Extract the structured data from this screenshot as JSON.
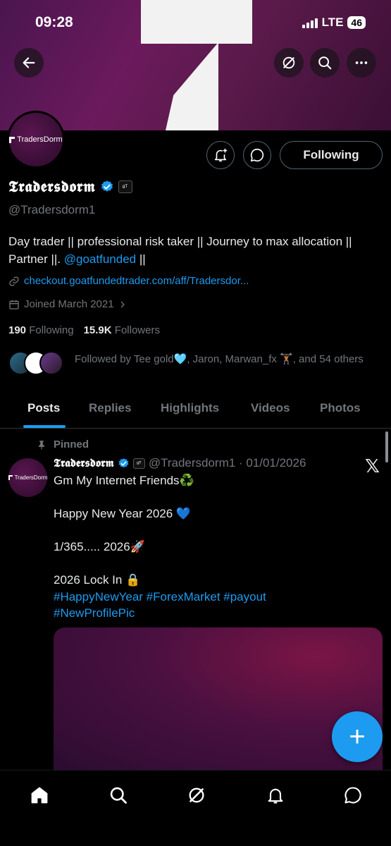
{
  "status_bar": {
    "time": "09:28",
    "network": "LTE",
    "battery": "46"
  },
  "profile": {
    "avatar_label": "TradersDorm",
    "name": "𝕿𝖗𝖆𝖉𝖊𝖗𝖘𝖉𝖔𝖗𝖒",
    "affiliate_badge": "ᵍᵀ",
    "handle": "@Tradersdorm1",
    "bio_text": "Day trader || professional risk taker || Journey to max allocation || Partner ||.",
    "bio_mention": "@goatfunded",
    "bio_suffix": "||",
    "link": "checkout.goatfundedtrader.com/aff/Tradersdor...",
    "joined": "Joined March 2021",
    "following_count": "190",
    "following_label": "Following",
    "followers_count": "15.9K",
    "followers_label": "Followers",
    "followed_by": "Followed by Tee gold🩵, Jaron, Marwan_fx 🏋🏿, and 54 others",
    "follow_button": "Following"
  },
  "tabs": [
    "Posts",
    "Replies",
    "Highlights",
    "Videos",
    "Photos"
  ],
  "post": {
    "pinned_label": "Pinned",
    "author": "𝕿𝖗𝖆𝖉𝖊𝖗𝖘𝖉𝖔𝖗𝖒",
    "handle_date": "@Tradersdorm1 · 01/01/2026",
    "line1": "Gm My Internet Friends♻️",
    "line2": "Happy New Year 2026 💙",
    "line3": "1/365..... 2026🚀",
    "line4": "2026 Lock In 🔒",
    "hashtags_1": "#HappyNewYear #ForexMarket #payout",
    "hashtags_2": "#NewProfilePic"
  },
  "fab_label": "+",
  "colors": {
    "accent": "#1d9bf0",
    "background": "#000000",
    "muted": "#71767b"
  }
}
